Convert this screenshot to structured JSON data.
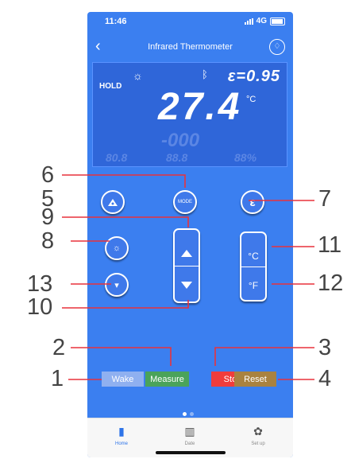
{
  "status": {
    "time": "11:46",
    "network": "4G"
  },
  "nav": {
    "back_icon": "chevron-left-icon",
    "title": "Infrared Thermometer",
    "alarm_icon": "alarm-icon"
  },
  "lcd": {
    "hold": "HOLD",
    "epsilon": "ε=0.95",
    "temperature": "27.4",
    "unit": "°C",
    "ghost_reading": "-000",
    "ghost_values": [
      "80.8",
      "88.8",
      "88%"
    ]
  },
  "buttons": {
    "mode": "MODE",
    "emissivity": "ε",
    "celsius": "°C",
    "fahrenheit": "°F",
    "up_icon": "triangle-up-icon",
    "down_icon": "triangle-down-icon"
  },
  "actions": {
    "wake": "Wake",
    "measure": "Measure",
    "stop": "Stop",
    "reset": "Reset",
    "colors": {
      "wake": "#8fb0f0",
      "measure": "#4aa35a",
      "stop": "#f03c3c",
      "reset": "#a98240"
    }
  },
  "tabs": [
    {
      "label": "Home",
      "icon": "thermometer-icon",
      "color": "#2e74e8"
    },
    {
      "label": "Date",
      "icon": "bar-chart-icon",
      "color": "#555555"
    },
    {
      "label": "Set up",
      "icon": "gear-icon",
      "color": "#555555"
    }
  ],
  "callouts": [
    "1",
    "2",
    "3",
    "4",
    "5",
    "6",
    "7",
    "8",
    "9",
    "10",
    "11",
    "12",
    "13"
  ]
}
